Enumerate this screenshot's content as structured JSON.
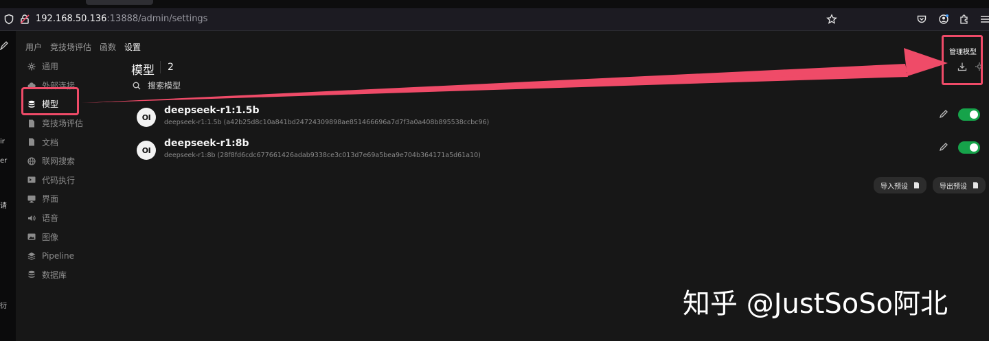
{
  "browser": {
    "url_host": "192.168.50.136",
    "url_path": ":13888/admin/settings"
  },
  "left_strip": [
    "ir",
    "er",
    "请",
    "衍"
  ],
  "tabs": [
    {
      "label": "用户",
      "active": false
    },
    {
      "label": "竞技场评估",
      "active": false
    },
    {
      "label": "函数",
      "active": false
    },
    {
      "label": "设置",
      "active": true
    }
  ],
  "nav": [
    {
      "label": "通用",
      "icon": "gear-icon",
      "active": false
    },
    {
      "label": "外部连接",
      "icon": "cloud-icon",
      "active": false
    },
    {
      "label": "模型",
      "icon": "database-icon",
      "active": true
    },
    {
      "label": "竞技场评估",
      "icon": "document-icon",
      "active": false
    },
    {
      "label": "文档",
      "icon": "document-icon",
      "active": false
    },
    {
      "label": "联网搜索",
      "icon": "globe-icon",
      "active": false
    },
    {
      "label": "代码执行",
      "icon": "terminal-icon",
      "active": false
    },
    {
      "label": "界面",
      "icon": "monitor-icon",
      "active": false
    },
    {
      "label": "语音",
      "icon": "speaker-icon",
      "active": false
    },
    {
      "label": "图像",
      "icon": "image-icon",
      "active": false
    },
    {
      "label": "Pipeline",
      "icon": "layers-icon",
      "active": false
    },
    {
      "label": "数据库",
      "icon": "database-icon",
      "active": false
    }
  ],
  "main": {
    "title": "模型",
    "count": "2",
    "search_placeholder": "搜索模型",
    "manage_label": "管理模型"
  },
  "models": [
    {
      "logo": "OI",
      "name": "deepseek-r1:1.5b",
      "description": "deepseek-r1:1.5b (a42b25d8c10a841bd24724309898ae851466696a7d7f3a0a408b895538ccbc96)",
      "enabled": true
    },
    {
      "logo": "OI",
      "name": "deepseek-r1:8b",
      "description": "deepseek-r1:8b (28f8fd6cdc677661426adab9338ce3c013d7e69a5bea9e704b364171a5d61a10)",
      "enabled": true
    }
  ],
  "buttons": {
    "import_label": "导入预设",
    "export_label": "导出预设"
  },
  "watermark": "知乎 @JustSoSo阿北",
  "colors": {
    "annotation": "#ef4b68",
    "toggle_on": "#16a34a",
    "background": "#171717"
  }
}
